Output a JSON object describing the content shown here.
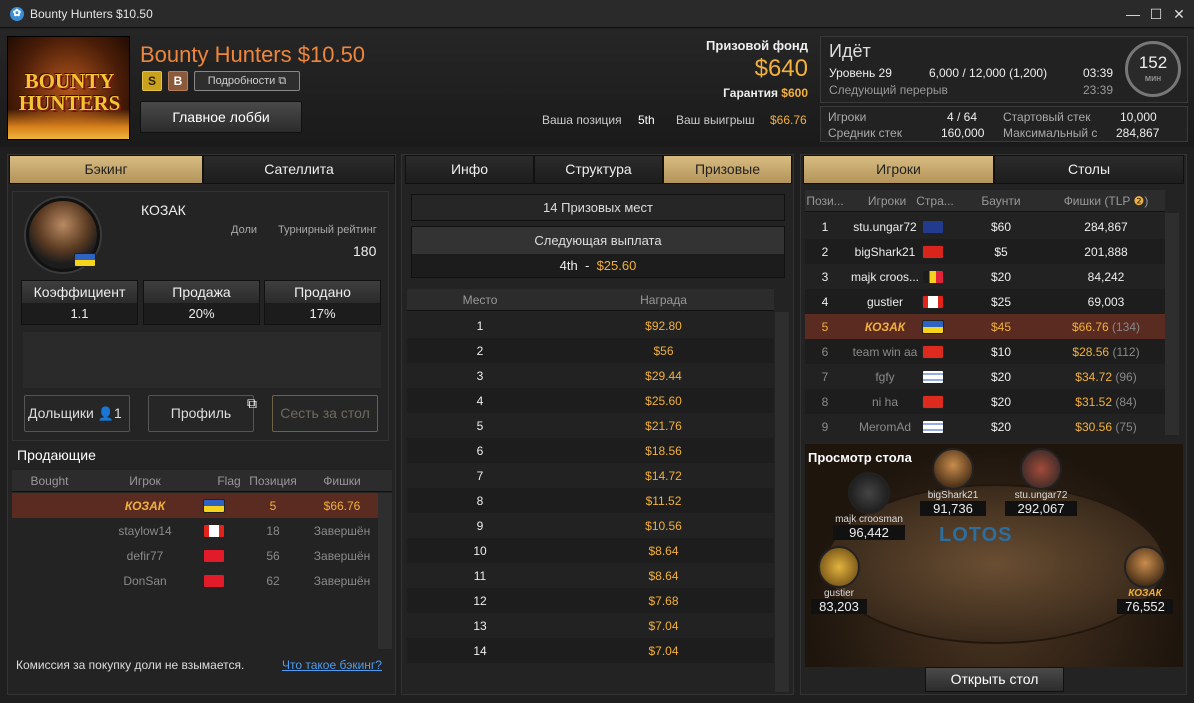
{
  "window": {
    "title": "Bounty Hunters $10.50",
    "app_icon": "lotos-icon"
  },
  "header": {
    "logo_line1": "BOUNTY",
    "logo_line2": "HUNTERS",
    "title": "Bounty Hunters $10.50",
    "badge_s": "S",
    "badge_b": "B",
    "details_label": "Подробности",
    "main_lobby": "Главное лобби",
    "prize_fund_label": "Призовой фонд",
    "prize_fund": "$640",
    "guarantee_label": "Гарантия",
    "guarantee": "$600",
    "position_label": "Ваша позиция",
    "position": "5th",
    "winnings_label": "Ваш выигрыш",
    "winnings": "$66.76"
  },
  "status": {
    "state": "Идёт",
    "level": "Уровень 29",
    "blinds": "6,000 / 12,000 (1,200)",
    "level_time": "03:39",
    "next_break": "Следующий перерыв",
    "break_time": "23:39",
    "clock_value": "152",
    "clock_unit": "мин"
  },
  "stats": {
    "players_label": "Игроки",
    "players": "4 / 64",
    "start_stack_label": "Стартовый стек",
    "start_stack": "10,000",
    "avg_stack_label": "Средник стек",
    "avg_stack": "160,000",
    "max_label": "Максимальный с",
    "max": "284,867"
  },
  "left": {
    "tabs": [
      "Бэкинг",
      "Сателлита"
    ],
    "player": "КОЗАК",
    "shares_label": "Доли",
    "rating_label": "Турнирный рейтинг",
    "rating": "180",
    "metrics": [
      {
        "label": "Коэффициент",
        "value": "1.1"
      },
      {
        "label": "Продажа",
        "value": "20%"
      },
      {
        "label": "Продано",
        "value": "17%"
      }
    ],
    "stakeholders_btn": "Дольщики",
    "stakeholders_count": "1",
    "profile_btn": "Профиль",
    "sit_btn": "Сесть за стол",
    "sellers_title": "Продающие",
    "sellers_headers": [
      "Bought",
      "Игрок",
      "Flag",
      "Позиция",
      "Фишки"
    ],
    "sellers": [
      {
        "player": "КОЗАК",
        "flag": "ua",
        "pos": "5",
        "chips": "$66.76"
      },
      {
        "player": "staylow14",
        "flag": "ca",
        "pos": "18",
        "chips": "Завершён"
      },
      {
        "player": "defir77",
        "flag": "tr",
        "pos": "56",
        "chips": "Завершён"
      },
      {
        "player": "DonSan",
        "flag": "ch",
        "pos": "62",
        "chips": "Завершён"
      }
    ],
    "note": "Комиссия за покупку доли не взымается.",
    "link": "Что такое бэкинг?"
  },
  "middle": {
    "tabs": [
      "Инфо",
      "Структура",
      "Призовые"
    ],
    "prize_places": "14 Призовых мест",
    "next_payout_label": "Следующая выплата",
    "next_payout_place": "4th",
    "next_payout_sep": "-",
    "next_payout_amount": "$25.60",
    "headers": [
      "Место",
      "Награда"
    ],
    "payouts": [
      {
        "place": "1",
        "prize": "$92.80"
      },
      {
        "place": "2",
        "prize": "$56"
      },
      {
        "place": "3",
        "prize": "$29.44"
      },
      {
        "place": "4",
        "prize": "$25.60"
      },
      {
        "place": "5",
        "prize": "$21.76"
      },
      {
        "place": "6",
        "prize": "$18.56"
      },
      {
        "place": "7",
        "prize": "$14.72"
      },
      {
        "place": "8",
        "prize": "$11.52"
      },
      {
        "place": "9",
        "prize": "$10.56"
      },
      {
        "place": "10",
        "prize": "$8.64"
      },
      {
        "place": "11",
        "prize": "$8.64"
      },
      {
        "place": "12",
        "prize": "$7.68"
      },
      {
        "place": "13",
        "prize": "$7.04"
      },
      {
        "place": "14",
        "prize": "$7.04"
      }
    ]
  },
  "right": {
    "tabs": [
      "Игроки",
      "Столы"
    ],
    "headers": [
      "Пози...",
      "Игроки",
      "Стра...",
      "Баунти",
      "Фишки (TLP"
    ],
    "players": [
      {
        "pos": "1",
        "name": "stu.ungar72",
        "flag": "gb",
        "bounty": "$60",
        "chips": "284,867",
        "extra": ""
      },
      {
        "pos": "2",
        "name": "bigShark21",
        "flag": "al",
        "bounty": "$5",
        "chips": "201,888",
        "extra": ""
      },
      {
        "pos": "3",
        "name": "majk croos...",
        "flag": "be",
        "bounty": "$20",
        "chips": "84,242",
        "extra": ""
      },
      {
        "pos": "4",
        "name": "gustier",
        "flag": "ca",
        "bounty": "$25",
        "chips": "69,003",
        "extra": ""
      },
      {
        "pos": "5",
        "name": "КОЗАК",
        "flag": "ua",
        "bounty": "$45",
        "chips": "$66.76",
        "extra": "(134)"
      },
      {
        "pos": "6",
        "name": "team win aa",
        "flag": "cn",
        "bounty": "$10",
        "chips": "$28.56",
        "extra": "(112)"
      },
      {
        "pos": "7",
        "name": "fgfy",
        "flag": "il",
        "bounty": "$20",
        "chips": "$34.72",
        "extra": "(96)"
      },
      {
        "pos": "8",
        "name": "ni ha",
        "flag": "cn",
        "bounty": "$20",
        "chips": "$31.52",
        "extra": "(84)"
      },
      {
        "pos": "9",
        "name": "MeromAd",
        "flag": "il",
        "bounty": "$20",
        "chips": "$30.56",
        "extra": "(75)"
      }
    ],
    "table_view_title": "Просмотр стола",
    "table_logo": "LOTOS",
    "seats": [
      {
        "name": "majk croosman",
        "stack": "96,442"
      },
      {
        "name": "bigShark21",
        "stack": "91,736"
      },
      {
        "name": "stu.ungar72",
        "stack": "292,067"
      },
      {
        "name": "gustier",
        "stack": "83,203"
      },
      {
        "name": "КОЗАК",
        "stack": "76,552"
      }
    ],
    "open_table": "Открыть стол"
  },
  "colors": {
    "accent_gold": "#f3b03b",
    "orange_title": "#f0863b",
    "tab_active": "#c9ab6e",
    "selected_row": "#5a2b21",
    "link": "#4f9cf0"
  }
}
